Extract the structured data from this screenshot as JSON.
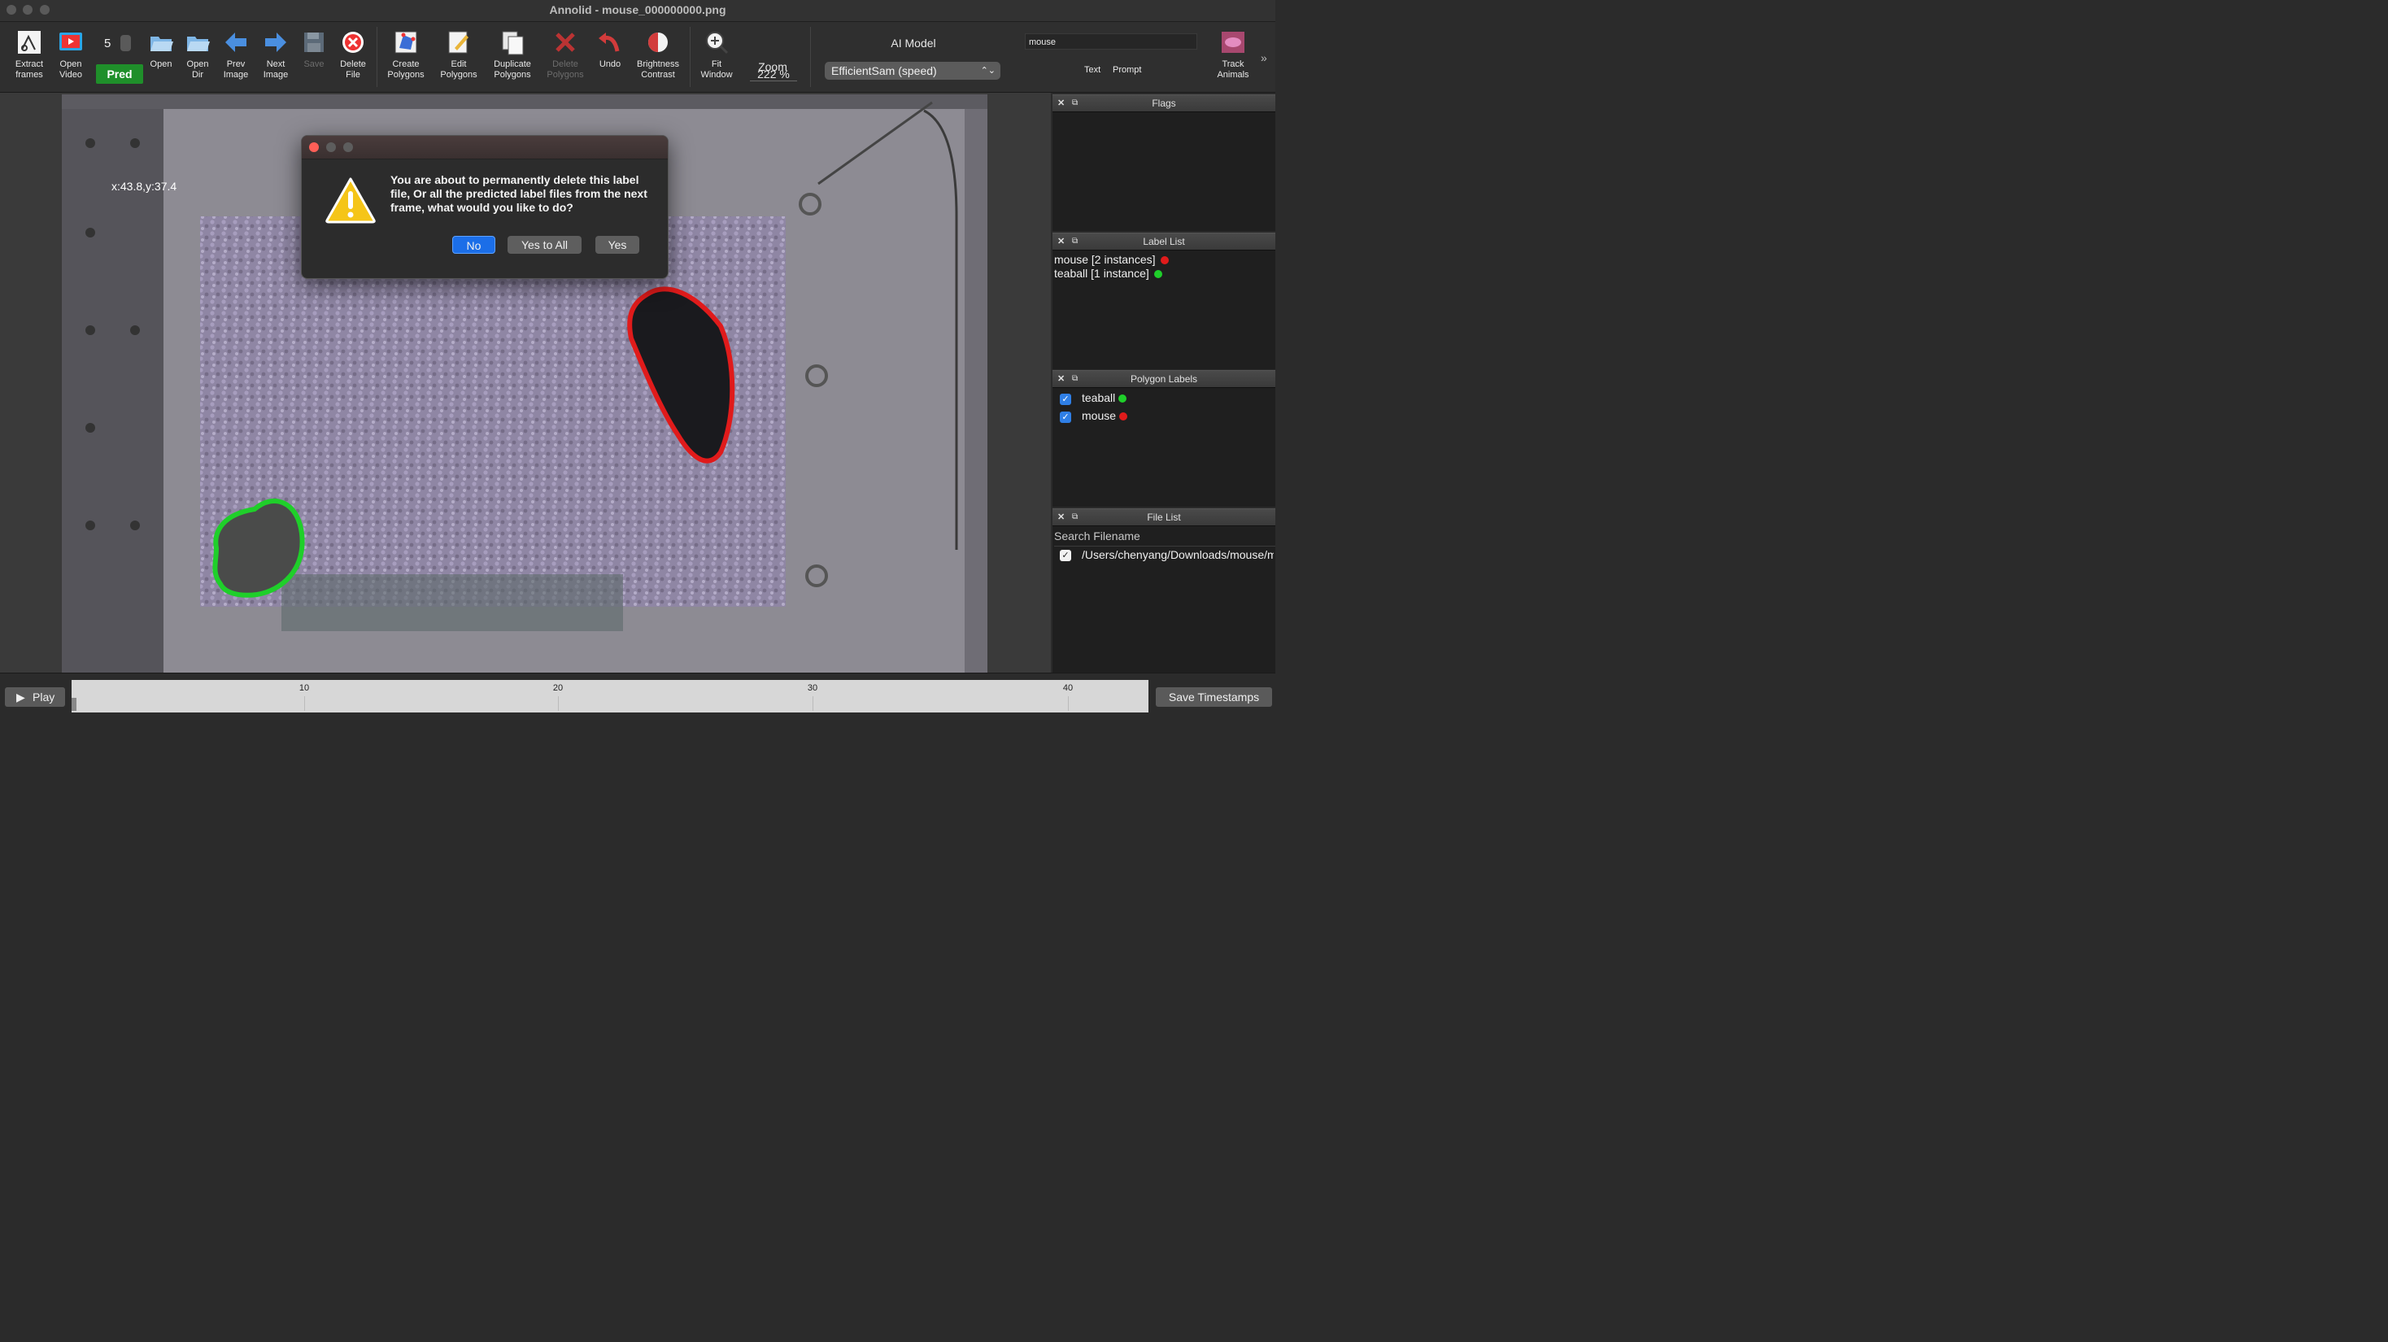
{
  "window": {
    "title": "Annolid - mouse_000000000.png"
  },
  "toolbar": {
    "extract_frames": "Extract\nframes",
    "open_video": "Open\nVideo",
    "frame_step": "5",
    "pred": "Pred",
    "open": "Open",
    "open_dir": "Open\nDir",
    "prev_image": "Prev\nImage",
    "next_image": "Next\nImage",
    "save": "Save",
    "delete_file": "Delete\nFile",
    "create_polygons": "Create\nPolygons",
    "edit_polygons": "Edit\nPolygons",
    "duplicate_polygons": "Duplicate\nPolygons",
    "delete_polygons": "Delete\nPolygons",
    "undo": "Undo",
    "brightness_contrast": "Brightness\nContrast",
    "fit_window": "Fit\nWindow",
    "zoom_label": "Zoom",
    "zoom_value": "222 %",
    "ai_model_label": "AI Model",
    "ai_model_value": "EfficientSam (speed)",
    "prompt_value": "mouse",
    "text_label": "Text",
    "prompt_label": "Prompt",
    "track_animals": "Track\nAnimals",
    "more": "»"
  },
  "canvas": {
    "coords": "x:43.8,y:37.4"
  },
  "dialog": {
    "message": "You are about to permanently delete this label file, Or all the predicted label files from the next frame, what would you like to do?",
    "no": "No",
    "yes_to_all": "Yes to All",
    "yes": "Yes"
  },
  "docks": {
    "flags": {
      "title": "Flags"
    },
    "label_list": {
      "title": "Label List",
      "items": [
        "mouse [2 instances]",
        "teaball [1 instance]"
      ]
    },
    "polygon_labels": {
      "title": "Polygon Labels",
      "items": [
        "teaball",
        "mouse"
      ]
    },
    "file_list": {
      "title": "File List",
      "search_placeholder": "Search Filename",
      "items": [
        "/Users/chenyang/Downloads/mouse/mo"
      ]
    }
  },
  "bottom": {
    "play": "Play",
    "save_timestamps": "Save Timestamps",
    "ticks": [
      "10",
      "20",
      "30",
      "40"
    ]
  },
  "colors": {
    "mouse": "#e01b1b",
    "teaball": "#1fcf2a",
    "pred_green": "#1f8f2a",
    "accent_blue": "#1b6ee8"
  }
}
